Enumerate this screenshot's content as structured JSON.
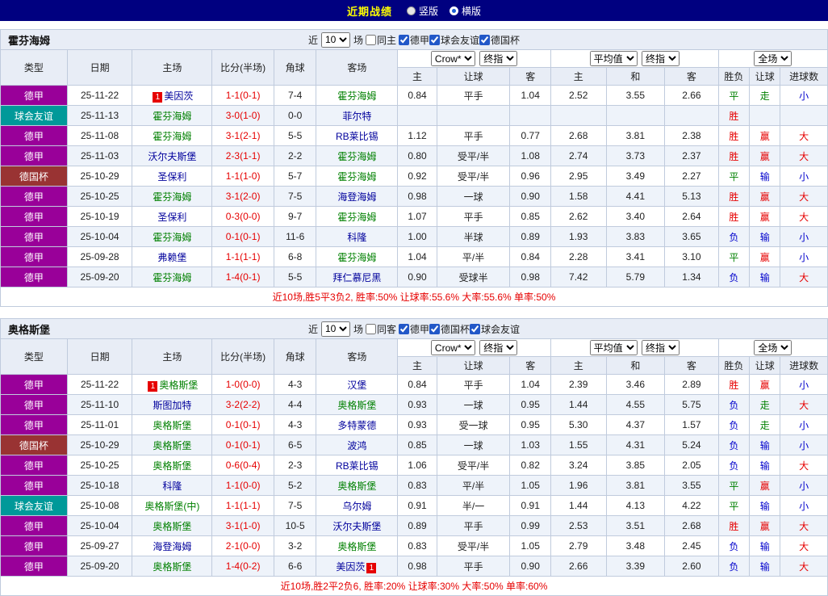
{
  "titlebar": {
    "title": "近期战绩",
    "radio_vertical": "竖版",
    "radio_horizontal": "横版"
  },
  "header_labels": {
    "near": "近",
    "count": "10",
    "games": "场",
    "main_cols": [
      "类型",
      "日期",
      "主场",
      "比分(半场)",
      "角球",
      "客场"
    ],
    "odds_cols": [
      "主",
      "让球",
      "客"
    ],
    "avg_cols": [
      "主",
      "和",
      "客"
    ],
    "result_cols": [
      "胜负",
      "让球",
      "进球数"
    ]
  },
  "selects": {
    "company": "Crow*",
    "company_time": "终指",
    "avg": "平均值",
    "avg_time": "终指",
    "scope": "全场"
  },
  "league_colors": {
    "德甲": "#990099",
    "球会友谊": "#009999",
    "德国杯": "#993333"
  },
  "result_colors": {
    "win": "#e60000",
    "draw": "#008000",
    "loss": "#0000cc"
  },
  "sections": [
    {
      "team": "霍芬海姆",
      "same_filter": "同主",
      "leagues": [
        "德甲",
        "球会友谊",
        "德国杯"
      ],
      "summary": "近10场,胜5平3负2, 胜率:50% 让球率:55.6% 大率:55.6% 单率:50%",
      "rows": [
        {
          "league": "德甲",
          "date": "25-11-22",
          "home": {
            "name": "美因茨",
            "rank": "1",
            "rank_pos": "before",
            "highlight": false
          },
          "score": "1-1(0-1)",
          "corners": "7-4",
          "away": {
            "name": "霍芬海姆",
            "highlight": true
          },
          "odds": [
            "0.84",
            "平手",
            "1.04"
          ],
          "avg": [
            "2.52",
            "3.55",
            "2.66"
          ],
          "results": [
            {
              "t": "平",
              "c": "draw"
            },
            {
              "t": "走",
              "c": "draw"
            },
            {
              "t": "小",
              "c": "loss"
            }
          ]
        },
        {
          "league": "球会友谊",
          "date": "25-11-13",
          "home": {
            "name": "霍芬海姆",
            "highlight": true
          },
          "score": "3-0(1-0)",
          "corners": "0-0",
          "away": {
            "name": "菲尔特",
            "highlight": false
          },
          "odds": [
            "",
            "",
            ""
          ],
          "avg": [
            "",
            "",
            ""
          ],
          "results": [
            {
              "t": "胜",
              "c": "win"
            },
            {
              "t": "",
              "c": ""
            },
            {
              "t": "",
              "c": ""
            }
          ]
        },
        {
          "league": "德甲",
          "date": "25-11-08",
          "home": {
            "name": "霍芬海姆",
            "highlight": true
          },
          "score": "3-1(2-1)",
          "corners": "5-5",
          "away": {
            "name": "RB莱比锡",
            "highlight": false
          },
          "odds": [
            "1.12",
            "平手",
            "0.77"
          ],
          "avg": [
            "2.68",
            "3.81",
            "2.38"
          ],
          "results": [
            {
              "t": "胜",
              "c": "win"
            },
            {
              "t": "赢",
              "c": "win"
            },
            {
              "t": "大",
              "c": "win"
            }
          ]
        },
        {
          "league": "德甲",
          "date": "25-11-03",
          "home": {
            "name": "沃尔夫斯堡",
            "highlight": false
          },
          "score": "2-3(1-1)",
          "corners": "2-2",
          "away": {
            "name": "霍芬海姆",
            "highlight": true
          },
          "odds": [
            "0.80",
            "受平/半",
            "1.08"
          ],
          "avg": [
            "2.74",
            "3.73",
            "2.37"
          ],
          "results": [
            {
              "t": "胜",
              "c": "win"
            },
            {
              "t": "赢",
              "c": "win"
            },
            {
              "t": "大",
              "c": "win"
            }
          ]
        },
        {
          "league": "德国杯",
          "date": "25-10-29",
          "home": {
            "name": "圣保利",
            "highlight": false
          },
          "score": "1-1(1-0)",
          "corners": "5-7",
          "away": {
            "name": "霍芬海姆",
            "highlight": true
          },
          "odds": [
            "0.92",
            "受平/半",
            "0.96"
          ],
          "avg": [
            "2.95",
            "3.49",
            "2.27"
          ],
          "results": [
            {
              "t": "平",
              "c": "draw"
            },
            {
              "t": "输",
              "c": "loss"
            },
            {
              "t": "小",
              "c": "loss"
            }
          ]
        },
        {
          "league": "德甲",
          "date": "25-10-25",
          "home": {
            "name": "霍芬海姆",
            "highlight": true
          },
          "score": "3-1(2-0)",
          "corners": "7-5",
          "away": {
            "name": "海登海姆",
            "highlight": false
          },
          "odds": [
            "0.98",
            "一球",
            "0.90"
          ],
          "avg": [
            "1.58",
            "4.41",
            "5.13"
          ],
          "results": [
            {
              "t": "胜",
              "c": "win"
            },
            {
              "t": "赢",
              "c": "win"
            },
            {
              "t": "大",
              "c": "win"
            }
          ]
        },
        {
          "league": "德甲",
          "date": "25-10-19",
          "home": {
            "name": "圣保利",
            "highlight": false
          },
          "score": "0-3(0-0)",
          "corners": "9-7",
          "away": {
            "name": "霍芬海姆",
            "highlight": true
          },
          "odds": [
            "1.07",
            "平手",
            "0.85"
          ],
          "avg": [
            "2.62",
            "3.40",
            "2.64"
          ],
          "results": [
            {
              "t": "胜",
              "c": "win"
            },
            {
              "t": "赢",
              "c": "win"
            },
            {
              "t": "大",
              "c": "win"
            }
          ]
        },
        {
          "league": "德甲",
          "date": "25-10-04",
          "home": {
            "name": "霍芬海姆",
            "highlight": true
          },
          "score": "0-1(0-1)",
          "corners": "11-6",
          "away": {
            "name": "科隆",
            "highlight": false
          },
          "odds": [
            "1.00",
            "半球",
            "0.89"
          ],
          "avg": [
            "1.93",
            "3.83",
            "3.65"
          ],
          "results": [
            {
              "t": "负",
              "c": "loss"
            },
            {
              "t": "输",
              "c": "loss"
            },
            {
              "t": "小",
              "c": "loss"
            }
          ]
        },
        {
          "league": "德甲",
          "date": "25-09-28",
          "home": {
            "name": "弗赖堡",
            "highlight": false
          },
          "score": "1-1(1-1)",
          "corners": "6-8",
          "away": {
            "name": "霍芬海姆",
            "highlight": true
          },
          "odds": [
            "1.04",
            "平/半",
            "0.84"
          ],
          "avg": [
            "2.28",
            "3.41",
            "3.10"
          ],
          "results": [
            {
              "t": "平",
              "c": "draw"
            },
            {
              "t": "赢",
              "c": "win"
            },
            {
              "t": "小",
              "c": "loss"
            }
          ]
        },
        {
          "league": "德甲",
          "date": "25-09-20",
          "home": {
            "name": "霍芬海姆",
            "highlight": true
          },
          "score": "1-4(0-1)",
          "corners": "5-5",
          "away": {
            "name": "拜仁慕尼黑",
            "highlight": false
          },
          "odds": [
            "0.90",
            "受球半",
            "0.98"
          ],
          "avg": [
            "7.42",
            "5.79",
            "1.34"
          ],
          "results": [
            {
              "t": "负",
              "c": "loss"
            },
            {
              "t": "输",
              "c": "loss"
            },
            {
              "t": "大",
              "c": "win"
            }
          ]
        }
      ]
    },
    {
      "team": "奥格斯堡",
      "same_filter": "同客",
      "leagues": [
        "德甲",
        "德国杯",
        "球会友谊"
      ],
      "summary": "近10场,胜2平2负6, 胜率:20% 让球率:30% 大率:50% 单率:60%",
      "rows": [
        {
          "league": "德甲",
          "date": "25-11-22",
          "home": {
            "name": "奥格斯堡",
            "rank": "1",
            "rank_pos": "before",
            "highlight": true
          },
          "score": "1-0(0-0)",
          "corners": "4-3",
          "away": {
            "name": "汉堡",
            "highlight": false
          },
          "odds": [
            "0.84",
            "平手",
            "1.04"
          ],
          "avg": [
            "2.39",
            "3.46",
            "2.89"
          ],
          "results": [
            {
              "t": "胜",
              "c": "win"
            },
            {
              "t": "赢",
              "c": "win"
            },
            {
              "t": "小",
              "c": "loss"
            }
          ]
        },
        {
          "league": "德甲",
          "date": "25-11-10",
          "home": {
            "name": "斯图加特",
            "highlight": false
          },
          "score": "3-2(2-2)",
          "corners": "4-4",
          "away": {
            "name": "奥格斯堡",
            "highlight": true
          },
          "odds": [
            "0.93",
            "一球",
            "0.95"
          ],
          "avg": [
            "1.44",
            "4.55",
            "5.75"
          ],
          "results": [
            {
              "t": "负",
              "c": "loss"
            },
            {
              "t": "走",
              "c": "draw"
            },
            {
              "t": "大",
              "c": "win"
            }
          ]
        },
        {
          "league": "德甲",
          "date": "25-11-01",
          "home": {
            "name": "奥格斯堡",
            "highlight": true
          },
          "score": "0-1(0-1)",
          "corners": "4-3",
          "away": {
            "name": "多特蒙德",
            "highlight": false
          },
          "odds": [
            "0.93",
            "受一球",
            "0.95"
          ],
          "avg": [
            "5.30",
            "4.37",
            "1.57"
          ],
          "results": [
            {
              "t": "负",
              "c": "loss"
            },
            {
              "t": "走",
              "c": "draw"
            },
            {
              "t": "小",
              "c": "loss"
            }
          ]
        },
        {
          "league": "德国杯",
          "date": "25-10-29",
          "home": {
            "name": "奥格斯堡",
            "highlight": true
          },
          "score": "0-1(0-1)",
          "corners": "6-5",
          "away": {
            "name": "波鸿",
            "highlight": false
          },
          "odds": [
            "0.85",
            "一球",
            "1.03"
          ],
          "avg": [
            "1.55",
            "4.31",
            "5.24"
          ],
          "results": [
            {
              "t": "负",
              "c": "loss"
            },
            {
              "t": "输",
              "c": "loss"
            },
            {
              "t": "小",
              "c": "loss"
            }
          ]
        },
        {
          "league": "德甲",
          "date": "25-10-25",
          "home": {
            "name": "奥格斯堡",
            "highlight": true
          },
          "score": "0-6(0-4)",
          "corners": "2-3",
          "away": {
            "name": "RB莱比锡",
            "highlight": false
          },
          "odds": [
            "1.06",
            "受平/半",
            "0.82"
          ],
          "avg": [
            "3.24",
            "3.85",
            "2.05"
          ],
          "results": [
            {
              "t": "负",
              "c": "loss"
            },
            {
              "t": "输",
              "c": "loss"
            },
            {
              "t": "大",
              "c": "win"
            }
          ]
        },
        {
          "league": "德甲",
          "date": "25-10-18",
          "home": {
            "name": "科隆",
            "highlight": false
          },
          "score": "1-1(0-0)",
          "corners": "5-2",
          "away": {
            "name": "奥格斯堡",
            "highlight": true
          },
          "odds": [
            "0.83",
            "平/半",
            "1.05"
          ],
          "avg": [
            "1.96",
            "3.81",
            "3.55"
          ],
          "results": [
            {
              "t": "平",
              "c": "draw"
            },
            {
              "t": "赢",
              "c": "win"
            },
            {
              "t": "小",
              "c": "loss"
            }
          ]
        },
        {
          "league": "球会友谊",
          "date": "25-10-08",
          "home": {
            "name": "奥格斯堡(中)",
            "highlight": true
          },
          "score": "1-1(1-1)",
          "corners": "7-5",
          "away": {
            "name": "乌尔姆",
            "highlight": false
          },
          "odds": [
            "0.91",
            "半/一",
            "0.91"
          ],
          "avg": [
            "1.44",
            "4.13",
            "4.22"
          ],
          "results": [
            {
              "t": "平",
              "c": "draw"
            },
            {
              "t": "输",
              "c": "loss"
            },
            {
              "t": "小",
              "c": "loss"
            }
          ]
        },
        {
          "league": "德甲",
          "date": "25-10-04",
          "home": {
            "name": "奥格斯堡",
            "highlight": true
          },
          "score": "3-1(1-0)",
          "corners": "10-5",
          "away": {
            "name": "沃尔夫斯堡",
            "highlight": false
          },
          "odds": [
            "0.89",
            "平手",
            "0.99"
          ],
          "avg": [
            "2.53",
            "3.51",
            "2.68"
          ],
          "results": [
            {
              "t": "胜",
              "c": "win"
            },
            {
              "t": "赢",
              "c": "win"
            },
            {
              "t": "大",
              "c": "win"
            }
          ]
        },
        {
          "league": "德甲",
          "date": "25-09-27",
          "home": {
            "name": "海登海姆",
            "highlight": false
          },
          "score": "2-1(0-0)",
          "corners": "3-2",
          "away": {
            "name": "奥格斯堡",
            "highlight": true
          },
          "odds": [
            "0.83",
            "受平/半",
            "1.05"
          ],
          "avg": [
            "2.79",
            "3.48",
            "2.45"
          ],
          "results": [
            {
              "t": "负",
              "c": "loss"
            },
            {
              "t": "输",
              "c": "loss"
            },
            {
              "t": "大",
              "c": "win"
            }
          ]
        },
        {
          "league": "德甲",
          "date": "25-09-20",
          "home": {
            "name": "奥格斯堡",
            "highlight": true
          },
          "score": "1-4(0-2)",
          "corners": "6-6",
          "away": {
            "name": "美因茨",
            "rank": "1",
            "rank_pos": "after",
            "highlight": false
          },
          "odds": [
            "0.98",
            "平手",
            "0.90"
          ],
          "avg": [
            "2.66",
            "3.39",
            "2.60"
          ],
          "results": [
            {
              "t": "负",
              "c": "loss"
            },
            {
              "t": "输",
              "c": "loss"
            },
            {
              "t": "大",
              "c": "win"
            }
          ]
        }
      ]
    }
  ]
}
